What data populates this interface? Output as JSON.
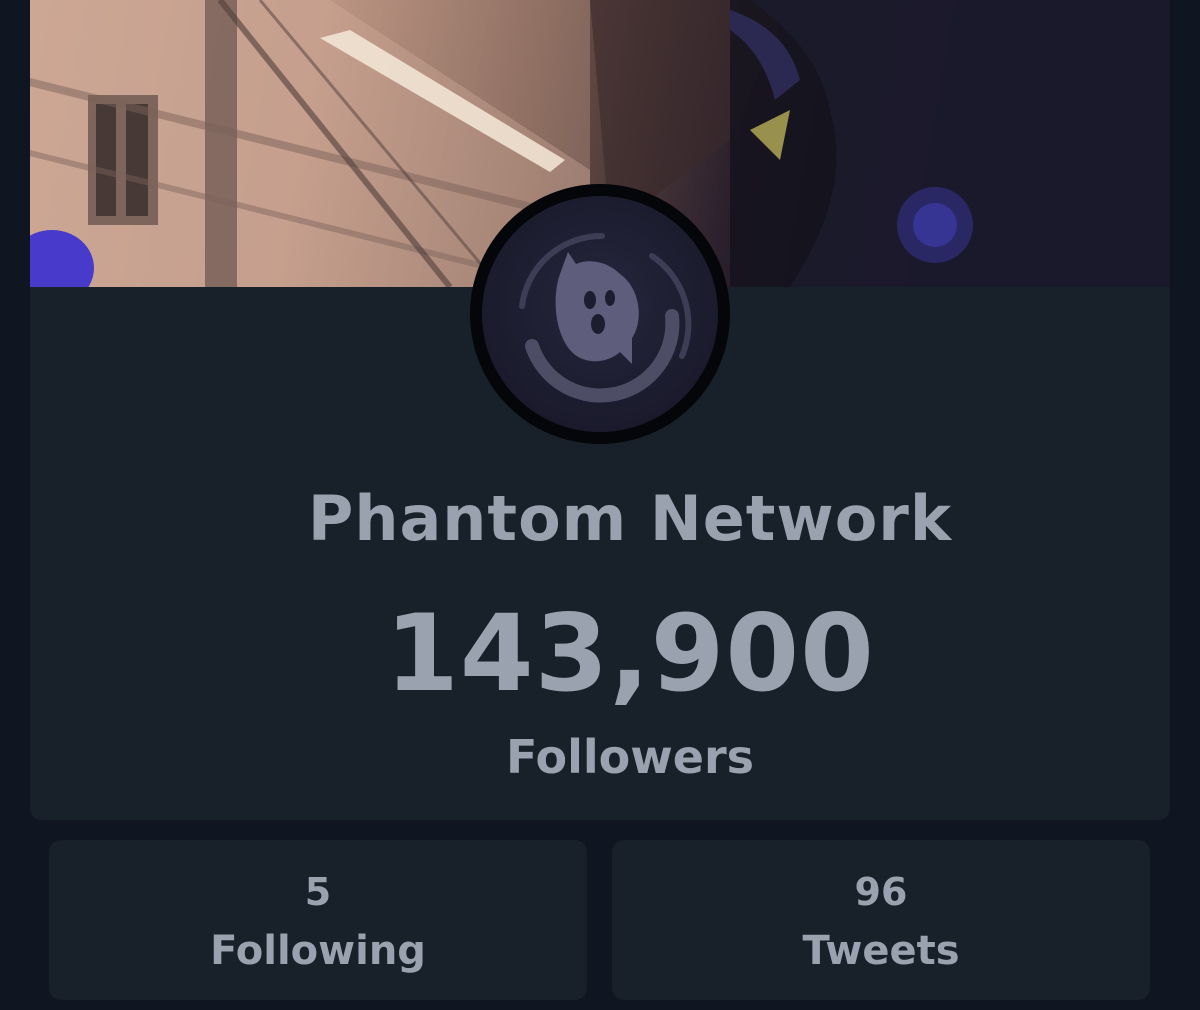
{
  "profile": {
    "name": "Phantom Network",
    "followers_count": "143,900",
    "followers_label": "Followers",
    "avatar_icon": "ghost-logo-icon"
  },
  "stats": {
    "following": {
      "value": "5",
      "label": "Following"
    },
    "tweets": {
      "value": "96",
      "label": "Tweets"
    }
  },
  "colors": {
    "page_background": "#0f1621",
    "card_background": "#182029",
    "text": "#9aa2b0",
    "avatar_ring": "#050609"
  }
}
